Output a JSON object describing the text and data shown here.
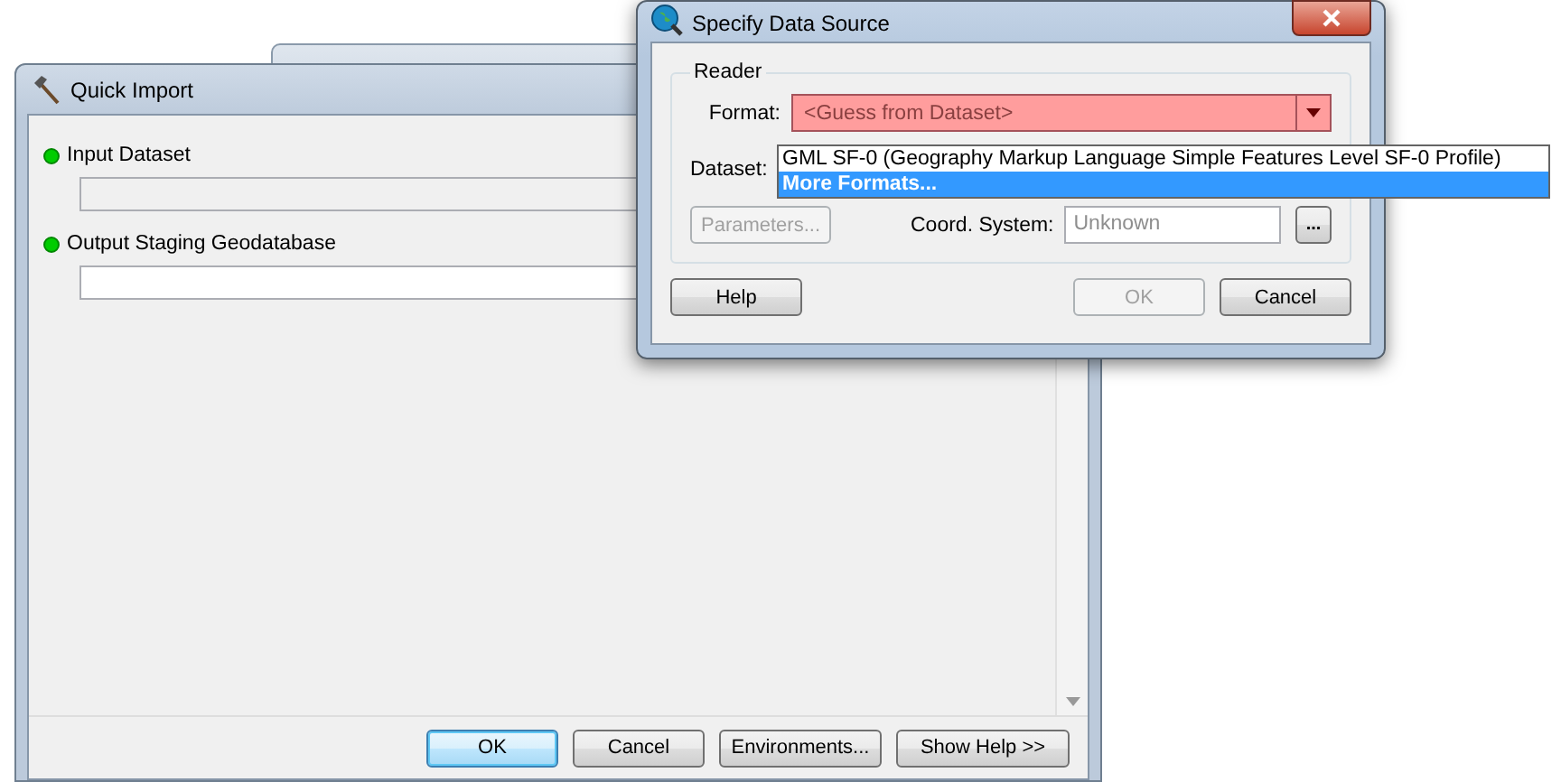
{
  "quick_import": {
    "title": "Quick Import",
    "fields": [
      {
        "label": "Input Dataset",
        "disabled": true
      },
      {
        "label": "Output Staging Geodatabase",
        "disabled": false
      }
    ],
    "buttons": [
      {
        "label": "OK",
        "default": true
      },
      {
        "label": "Cancel",
        "default": false
      },
      {
        "label": "Environments...",
        "default": false
      },
      {
        "label": "Show Help >>",
        "default": false
      }
    ]
  },
  "specify_data_source": {
    "title": "Specify Data Source",
    "group": "Reader",
    "format": {
      "label": "Format:",
      "value": "<Guess from Dataset>",
      "invalid": true
    },
    "format_options": [
      {
        "label": "GML SF-0 (Geography Markup Language Simple Features Level SF-0 Profile)",
        "selected": false
      },
      {
        "label": "More Formats...",
        "selected": true
      }
    ],
    "dataset_label": "Dataset:",
    "parameters_button": {
      "label": "Parameters...",
      "disabled": true
    },
    "coord_system": {
      "label": "Coord. System:",
      "value": "Unknown",
      "disabled": true
    },
    "browse_button": "...",
    "buttons": [
      {
        "label": "Help",
        "disabled": false
      },
      {
        "label": "OK",
        "disabled": true
      },
      {
        "label": "Cancel",
        "disabled": false
      }
    ]
  }
}
